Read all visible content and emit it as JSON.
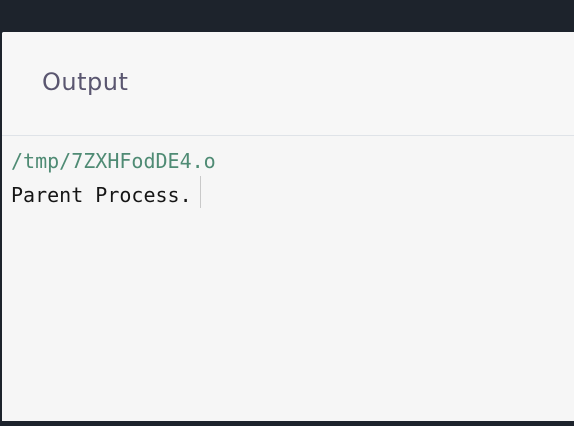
{
  "output_panel": {
    "title": "Output",
    "lines": [
      {
        "text": "/tmp/7ZXHFodDE4.o",
        "kind": "path"
      },
      {
        "text": "Parent Process.",
        "kind": "stdout"
      }
    ]
  },
  "colors": {
    "background": "#1d232c",
    "panel": "#f6f6f6",
    "path_text": "#4f8b74",
    "output_text": "#161616",
    "title_text": "#5a5670"
  }
}
